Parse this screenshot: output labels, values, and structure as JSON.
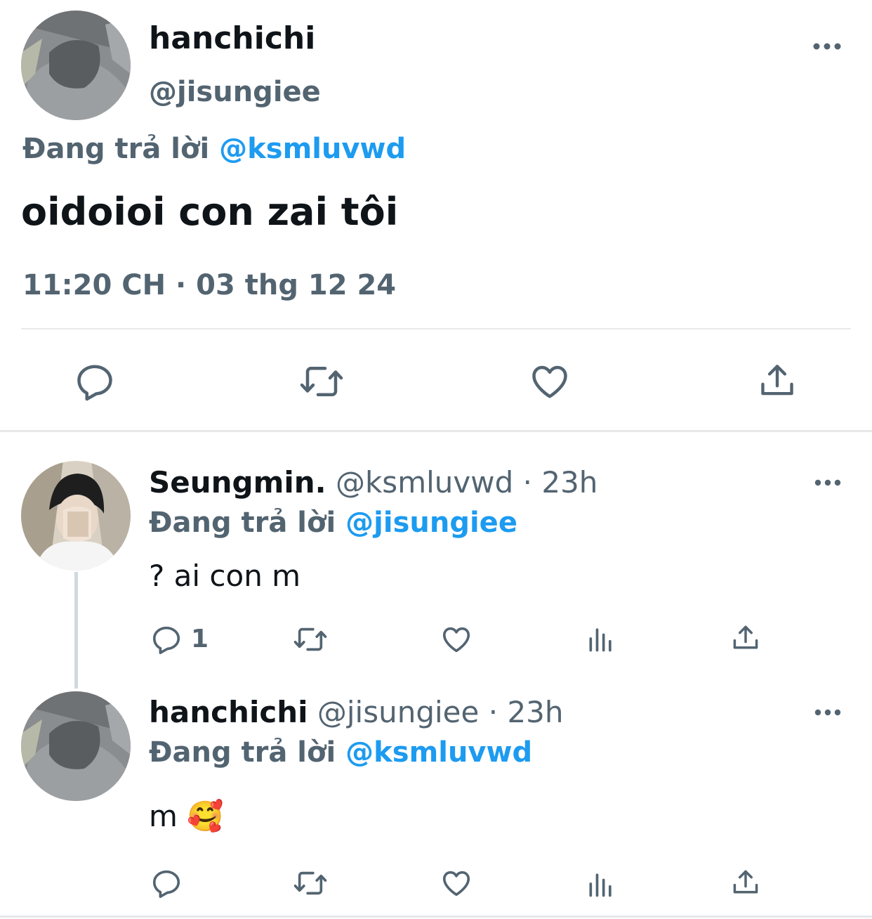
{
  "main_tweet": {
    "display_name": "hanchichi",
    "handle": "@jisungiee",
    "reply_prefix": "Đang trả lời",
    "reply_to": "@ksmluvwd",
    "text": "oidoioi con zai tôi",
    "timestamp": "11:20 CH · 03 thg 12 24",
    "actions": [
      "reply-icon",
      "retweet-icon",
      "like-icon",
      "share-icon"
    ]
  },
  "replies": [
    {
      "display_name": "Seungmin.",
      "handle": "@ksmluvwd",
      "separator": "·",
      "time": "23h",
      "reply_prefix": "Đang trả lời",
      "reply_to": "@jisungiee",
      "text": "? ai con m",
      "reply_count": "1",
      "actions": [
        "reply-icon",
        "retweet-icon",
        "like-icon",
        "views-icon",
        "share-icon"
      ]
    },
    {
      "display_name": "hanchichi",
      "handle": "@jisungiee",
      "separator": "·",
      "time": "23h",
      "reply_prefix": "Đang trả lời",
      "reply_to": "@ksmluvwd",
      "text": "m",
      "emoji": "🥰",
      "actions": [
        "reply-icon",
        "retweet-icon",
        "like-icon",
        "views-icon",
        "share-icon"
      ]
    }
  ],
  "colors": {
    "accent": "#1d9bf0",
    "muted": "#536471",
    "text": "#0f1419",
    "divider": "#e6e8ea"
  }
}
